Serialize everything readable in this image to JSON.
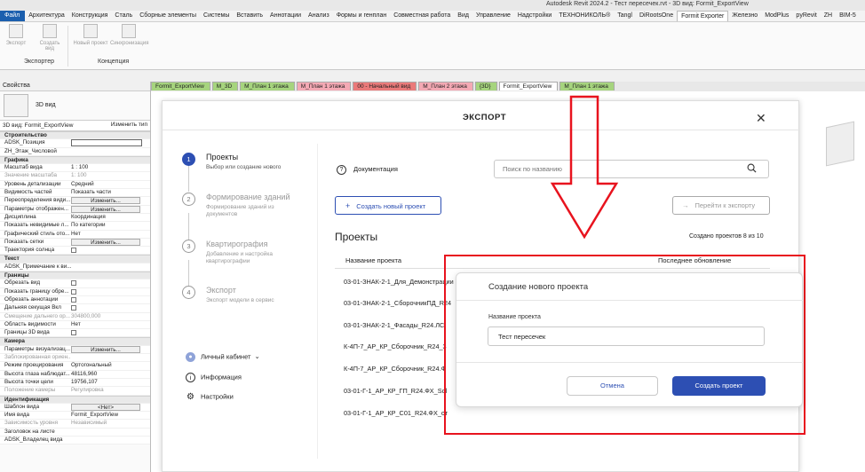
{
  "window": {
    "title": "Autodesk Revit 2024.2 - Тест пересечек.rvt - 3D вид: Formit_ExportView"
  },
  "ribbon": {
    "tabs": [
      "Файл",
      "Архитектура",
      "Конструкция",
      "Сталь",
      "Сборные элементы",
      "Системы",
      "Вставить",
      "Аннотации",
      "Анализ",
      "Формы и генплан",
      "Совместная работа",
      "Вид",
      "Управление",
      "Надстройки",
      "ТЕХНОНИКОЛЬ®",
      "Tangl",
      "DiRootsOne",
      "Formit Exporter",
      "Железно",
      "ModPlus",
      "pyRevit",
      "ZH",
      "BIM-5"
    ],
    "active_tab": "Formit Exporter",
    "buttons": [
      "Экспорт",
      "Создать вид",
      "Новый проект",
      "Синхронизация"
    ],
    "groups": [
      "Экспортер",
      "Концепция"
    ]
  },
  "view_tabs": [
    {
      "label": "Formit_ExportView",
      "color": "green"
    },
    {
      "label": "M_3D",
      "color": "green"
    },
    {
      "label": "M_План 1 этажа",
      "color": "green"
    },
    {
      "label": "M_План 1 этажа",
      "color": "pink"
    },
    {
      "label": "00 - Начальный вид",
      "color": "red"
    },
    {
      "label": "M_План 2 этажа",
      "color": "pink"
    },
    {
      "label": "{3D}",
      "color": "green"
    },
    {
      "label": "Formit_ExportView",
      "color": "active"
    },
    {
      "label": "M_План 1 этажа",
      "color": "green"
    }
  ],
  "properties": {
    "header": "Свойства",
    "type_name": "3D вид",
    "selector": "3D вид: Formit_ExportView",
    "edit_type": "Изменить тип",
    "rows": [
      {
        "k": "Строительство",
        "sec": true
      },
      {
        "k": "ADSK_Позиция",
        "v": "",
        "inp": true
      },
      {
        "k": "ZH_Этаж_Числовой",
        "v": ""
      },
      {
        "k": "Графика",
        "sec": true
      },
      {
        "k": "Масштаб вида",
        "v": "1 : 100"
      },
      {
        "k": "Значение масштаба",
        "v": "1:  100",
        "dim": true
      },
      {
        "k": "Уровень детализации",
        "v": "Средний"
      },
      {
        "k": "Видимость частей",
        "v": "Показать части"
      },
      {
        "k": "Переопределения види...",
        "v": "Изменить...",
        "btn": true
      },
      {
        "k": "Параметры отображен...",
        "v": "Изменить...",
        "btn": true
      },
      {
        "k": "Дисциплина",
        "v": "Координация"
      },
      {
        "k": "Показать невидимые л...",
        "v": "По категории"
      },
      {
        "k": "Графический стиль ото...",
        "v": "Нет"
      },
      {
        "k": "Показать сетки",
        "v": "Изменить...",
        "btn": true
      },
      {
        "k": "Траектория солнца",
        "v": "",
        "cb": true
      },
      {
        "k": "Текст",
        "sec": true
      },
      {
        "k": "ADSK_Примечание к ви...",
        "v": ""
      },
      {
        "k": "Границы",
        "sec": true
      },
      {
        "k": "Обрезать вид",
        "v": "",
        "cb": true
      },
      {
        "k": "Показать границу обре...",
        "v": "",
        "cb": true
      },
      {
        "k": "Обрезать аннотации",
        "v": "",
        "cb": true
      },
      {
        "k": "Дальняя секущая Вкл",
        "v": "",
        "cb": true
      },
      {
        "k": "Смещение дальнего ор...",
        "v": "304800,000",
        "dim": true
      },
      {
        "k": "Область видимости",
        "v": "Нет"
      },
      {
        "k": "Границы 3D вида",
        "v": "",
        "cb": true
      },
      {
        "k": "Камера",
        "sec": true
      },
      {
        "k": "Параметры визуализац...",
        "v": "Изменить...",
        "btn": true
      },
      {
        "k": "Заблокированная ориен...",
        "v": "",
        "dim": true
      },
      {
        "k": "Режим проецирования",
        "v": "Ортогональный"
      },
      {
        "k": "Высота глаза наблюдат...",
        "v": "48116,960"
      },
      {
        "k": "Высота точки цели",
        "v": "19756,107"
      },
      {
        "k": "Положение камеры",
        "v": "Регулировка",
        "dim": true
      },
      {
        "k": "Идентификация",
        "sec": true
      },
      {
        "k": "Шаблон вида",
        "v": "<Нет>",
        "btn": true
      },
      {
        "k": "Имя вида",
        "v": "Formit_ExportView"
      },
      {
        "k": "Зависимость уровня",
        "v": "Независимый",
        "dim": true
      },
      {
        "k": "Заголовок на листе",
        "v": ""
      },
      {
        "k": "ADSK_Владелец вида",
        "v": ""
      }
    ]
  },
  "export_modal": {
    "title": "ЭКСПОРТ",
    "steps": [
      {
        "num": "1",
        "title": "Проекты",
        "subtitle": "Выбор или создание нового",
        "active": true
      },
      {
        "num": "2",
        "title": "Формирование зданий",
        "subtitle": "Формирование зданий из документов",
        "active": false
      },
      {
        "num": "3",
        "title": "Квартирография",
        "subtitle": "Добавление и настройка квартирографии",
        "active": false
      },
      {
        "num": "4",
        "title": "Экспорт",
        "subtitle": "Экспорт модели в сервис",
        "active": false
      }
    ],
    "nav": [
      {
        "label": "Личный кабинет",
        "icon": "user-icon"
      },
      {
        "label": "Информация",
        "icon": "info-icon"
      },
      {
        "label": "Настройки",
        "icon": "gear-icon"
      }
    ],
    "documentation": "Документация",
    "search_placeholder": "Поиск по названию",
    "create_new_project": "Создать новый проект",
    "go_to_export": "Перейти к экспорту",
    "projects_label": "Проекты",
    "projects_count": "Создано проектов 8 из 10",
    "columns": [
      "Название проекта",
      "Последнее обновление"
    ],
    "projects": [
      "03-01-ЗНАК-2-1_Для_Демонстрации",
      "03-01-ЗНАК-2-1_СборочникПД_R24",
      "03-01-ЗНАК-2-1_Фасады_R24.ЛС",
      "К-4П-7_АР_КР_Сборочник_R24_3",
      "К-4П-7_АР_КР_Сборочник_R24.Ф",
      "03-01-Г-1_АР_КР_ГП_R24.ФХ_Sol",
      "03-01-Г-1_АР_КР_С01_R24.ФХ_от"
    ]
  },
  "create_dialog": {
    "title": "Создание нового проекта",
    "field_label": "Название проекта",
    "field_value": "Тест пересечек",
    "cancel": "Отмена",
    "submit": "Создать проект"
  },
  "colors": {
    "accent": "#2d4fb3",
    "highlight": "#e8131e",
    "revit_blue": "#1b5fae"
  }
}
